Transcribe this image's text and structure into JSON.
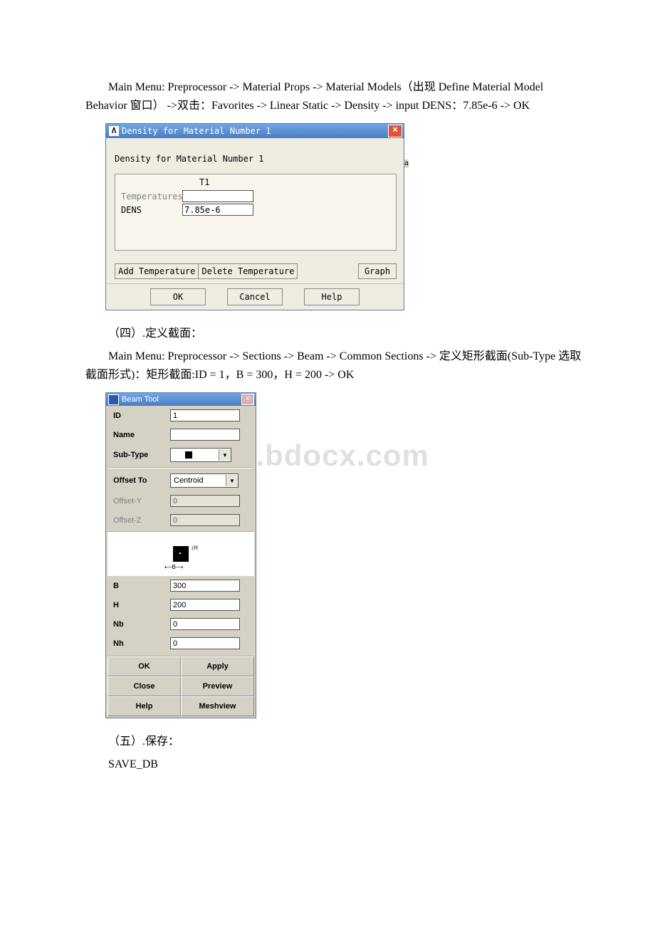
{
  "text": {
    "p1": "Main Menu: Preprocessor -> Material Props -> Material Models（出现 Define Material Model Behavior 窗口） ->双击：Favorites -> Linear Static -> Density -> input DENS：7.85e-6 -> OK",
    "hdr4": "（四）.定义截面：",
    "p2": "Main Menu: Preprocessor -> Sections -> Beam -> Common Sections -> 定义矩形截面(Sub-Type 选取截面形式)：矩形截面:ID = 1，B = 300，H = 200 -> OK",
    "hdr5": "（五）.保存：",
    "save": "SAVE_DB"
  },
  "density_dialog": {
    "title": "Density for Material Number 1",
    "logo": "Λ",
    "subtitle": "Density for Material Number 1",
    "col_header": "T1",
    "row_temp": "Temperatures",
    "row_dens": "DENS",
    "dens_value": "7.85e-6",
    "btn_add": "Add Temperature",
    "btn_del": "Delete Temperature",
    "btn_graph": "Graph",
    "btn_ok": "OK",
    "btn_cancel": "Cancel",
    "btn_help": "Help",
    "ext_marker": "a"
  },
  "beam_dialog": {
    "title": "Beam Tool",
    "lbl_id": "ID",
    "val_id": "1",
    "lbl_name": "Name",
    "val_name": "",
    "lbl_subtype": "Sub-Type",
    "lbl_offset_to": "Offset To",
    "val_offset_to": "Centroid",
    "lbl_offset_y": "Offset-Y",
    "val_offset_y": "0",
    "lbl_offset_z": "Offset-Z",
    "val_offset_z": "0",
    "lbl_b": "B",
    "val_b": "300",
    "lbl_h": "H",
    "val_h": "200",
    "lbl_nb": "Nb",
    "val_nb": "0",
    "lbl_nh": "Nh",
    "val_nh": "0",
    "preview_h": "H",
    "preview_b": "B",
    "btn_ok": "OK",
    "btn_apply": "Apply",
    "btn_close": "Close",
    "btn_preview": "Preview",
    "btn_help": "Help",
    "btn_meshview": "Meshview"
  },
  "watermark": "www.bdocx.com"
}
